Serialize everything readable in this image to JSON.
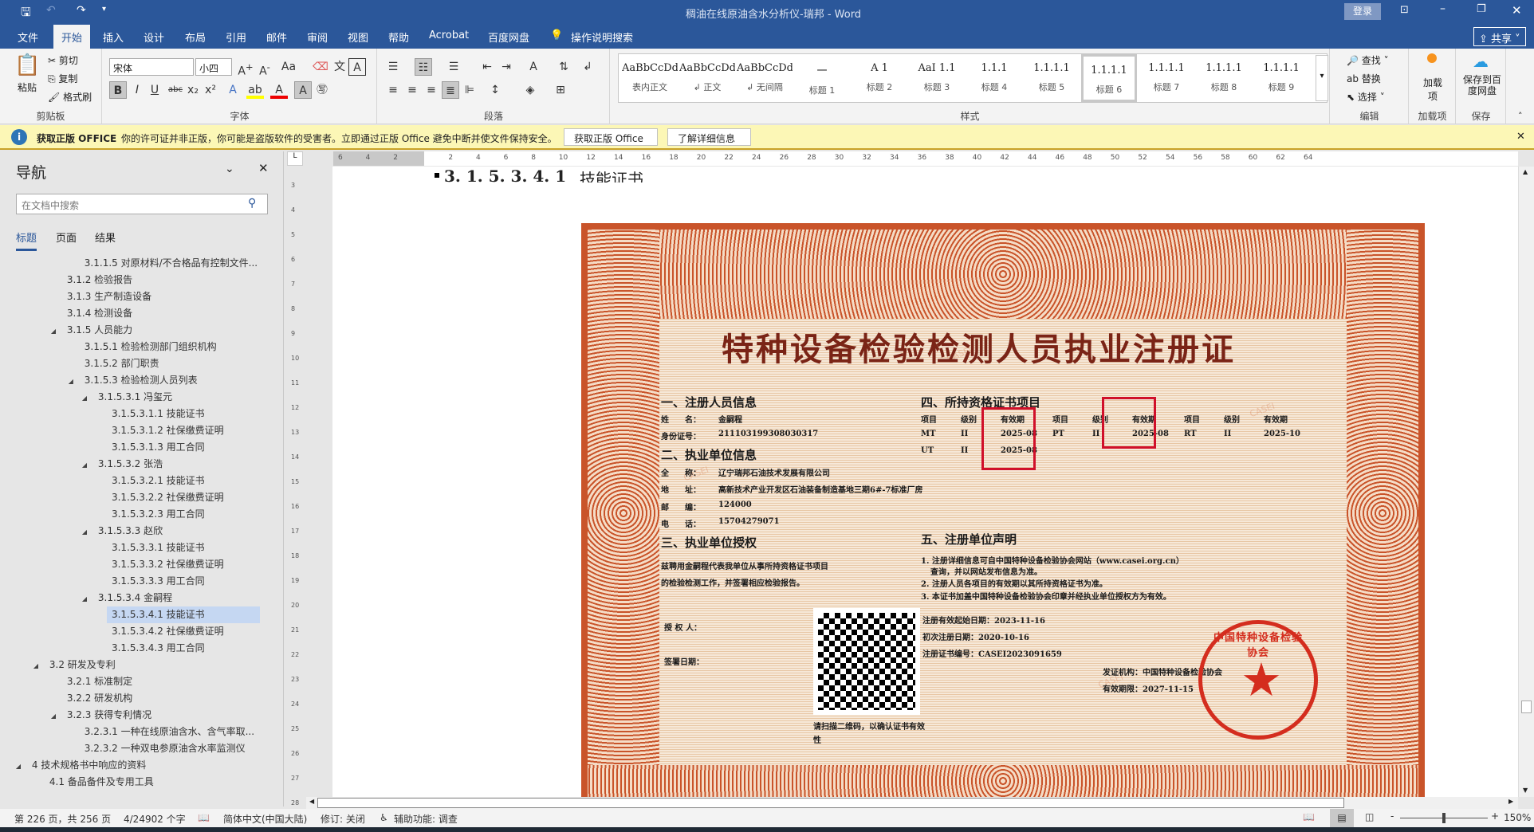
{
  "titlebar": {
    "title": "稠油在线原油含水分析仪-瑞邦 - Word",
    "login": "登录"
  },
  "tabs": [
    "文件",
    "开始",
    "插入",
    "设计",
    "布局",
    "引用",
    "邮件",
    "审阅",
    "视图",
    "帮助",
    "Acrobat",
    "百度网盘"
  ],
  "tell_me": "操作说明搜索",
  "share": "共享",
  "ribbon": {
    "clipboard": {
      "label": "剪贴板",
      "paste": "粘贴",
      "cut": "剪切",
      "copy": "复制",
      "format_painter": "格式刷"
    },
    "font": {
      "label": "字体",
      "font_name": "宋体",
      "font_size": "小四"
    },
    "paragraph": {
      "label": "段落"
    },
    "styles": {
      "label": "样式",
      "items": [
        {
          "preview": "AaBbCcDdI",
          "name": "表内正文"
        },
        {
          "preview": "AaBbCcDdI",
          "name": "↲ 正文"
        },
        {
          "preview": "AaBbCcDdI",
          "name": "↲ 无间隔"
        },
        {
          "preview": "一",
          "name": "标题 1"
        },
        {
          "preview": "A 1",
          "name": "标题 2"
        },
        {
          "preview": "AaI 1.1",
          "name": "标题 3"
        },
        {
          "preview": "1.1.1",
          "name": "标题 4"
        },
        {
          "preview": "1.1.1.1",
          "name": "标题 5"
        },
        {
          "preview": "1.1.1.1",
          "name": "标题 6"
        },
        {
          "preview": "1.1.1.1",
          "name": "标题 7"
        },
        {
          "preview": "1.1.1.1",
          "name": "标题 8"
        },
        {
          "preview": "1.1.1.1",
          "name": "标题 9"
        }
      ]
    },
    "editing": {
      "label": "编辑",
      "find": "查找",
      "replace": "替换",
      "select": "选择"
    },
    "addins": {
      "label": "加载项",
      "button": "加载项"
    },
    "save": {
      "label": "保存",
      "button": "保存到百度网盘"
    }
  },
  "msgbar": {
    "title": "获取正版 OFFICE",
    "text": "你的许可证并非正版，你可能是盗版软件的受害者。立即通过正版 Office 避免中断并使文件保持安全。",
    "btn1": "获取正版 Office",
    "btn2": "了解详细信息"
  },
  "nav": {
    "title": "导航",
    "search_placeholder": "在文档中搜索",
    "tabs": [
      "标题",
      "页面",
      "结果"
    ],
    "items": [
      {
        "level": 3,
        "text": "3.1.1.5 对原材料/不合格品有控制文件..."
      },
      {
        "level": 2,
        "text": "3.1.2 检验报告"
      },
      {
        "level": 2,
        "text": "3.1.3 生产制造设备"
      },
      {
        "level": 2,
        "text": "3.1.4 检测设备"
      },
      {
        "level": 2,
        "text": "3.1.5 人员能力",
        "expanded": true
      },
      {
        "level": 3,
        "text": "3.1.5.1 检验检测部门组织机构"
      },
      {
        "level": 3,
        "text": "3.1.5.2 部门职责"
      },
      {
        "level": 3,
        "text": "3.1.5.3 检验检测人员列表",
        "expanded": true
      },
      {
        "level": 4,
        "text": "3.1.5.3.1 冯玺元",
        "expanded": true
      },
      {
        "level": 5,
        "text": "3.1.5.3.1.1 技能证书"
      },
      {
        "level": 5,
        "text": "3.1.5.3.1.2 社保缴费证明"
      },
      {
        "level": 5,
        "text": "3.1.5.3.1.3 用工合同"
      },
      {
        "level": 4,
        "text": "3.1.5.3.2 张浩",
        "expanded": true
      },
      {
        "level": 5,
        "text": "3.1.5.3.2.1 技能证书"
      },
      {
        "level": 5,
        "text": "3.1.5.3.2.2 社保缴费证明"
      },
      {
        "level": 5,
        "text": "3.1.5.3.2.3 用工合同"
      },
      {
        "level": 4,
        "text": "3.1.5.3.3 赵欣",
        "expanded": true
      },
      {
        "level": 5,
        "text": "3.1.5.3.3.1 技能证书"
      },
      {
        "level": 5,
        "text": "3.1.5.3.3.2 社保缴费证明"
      },
      {
        "level": 5,
        "text": "3.1.5.3.3.3  用工合同"
      },
      {
        "level": 4,
        "text": "3.1.5.3.4 金嗣程",
        "expanded": true
      },
      {
        "level": 5,
        "text": "3.1.5.3.4.1 技能证书",
        "selected": true
      },
      {
        "level": 5,
        "text": "3.1.5.3.4.2 社保缴费证明"
      },
      {
        "level": 5,
        "text": "3.1.5.3.4.3 用工合同"
      },
      {
        "level": 1,
        "text": "3.2 研发及专利",
        "expanded": true
      },
      {
        "level": 2,
        "text": "3.2.1 标准制定"
      },
      {
        "level": 2,
        "text": "3.2.2 研发机构"
      },
      {
        "level": 2,
        "text": "3.2.3 获得专利情况",
        "expanded": true
      },
      {
        "level": 3,
        "text": "3.2.3.1 一种在线原油含水、含气率取..."
      },
      {
        "level": 3,
        "text": "3.2.3.2 一种双电参原油含水率监测仪"
      },
      {
        "level": 0,
        "text": "4 技术规格书中响应的资料",
        "expanded": true
      },
      {
        "level": 1,
        "text": "4.1 备品备件及专用工具"
      }
    ]
  },
  "doc": {
    "heading_num": "3. 1. 5. 3. 4. 1",
    "heading_text": "技能证书",
    "ruler": [
      "6",
      "4",
      "2",
      "",
      "2",
      "4",
      "6",
      "8",
      "10",
      "12",
      "14",
      "16",
      "18",
      "20",
      "22",
      "24",
      "26",
      "28",
      "30",
      "32",
      "34",
      "36",
      "38",
      "40",
      "42",
      "44",
      "46",
      "48",
      "50",
      "52",
      "54",
      "56",
      "58",
      "60",
      "62",
      "64"
    ],
    "vruler": [
      "3",
      "4",
      "5",
      "6",
      "7",
      "8",
      "9",
      "10",
      "11",
      "12",
      "13",
      "14",
      "15",
      "16",
      "17",
      "18",
      "19",
      "20",
      "21",
      "22",
      "23",
      "24",
      "25",
      "26",
      "27",
      "28"
    ]
  },
  "cert": {
    "title": "特种设备检验检测人员执业注册证",
    "watermark": "CASEI",
    "s1": "一、注册人员信息",
    "name_label": "姓　　名：",
    "name": "金嗣程",
    "id_label": "身份证号：",
    "id": "211103199308030317",
    "s2": "二、执业单位信息",
    "org_label": "全　　称：",
    "org": "辽宁瑞邦石油技术发展有限公司",
    "addr_label": "地　　址：",
    "addr": "高新技术产业开发区石油装备制造基地三期6#-7标准厂房",
    "zip_label": "邮　　编：",
    "zip": "124000",
    "tel_label": "电　　话：",
    "tel": "15704279071",
    "s3": "三、执业单位授权",
    "auth1": "兹聘用金嗣程代表我单位从事所持资格证书项目",
    "auth2": "的检验检测工作，并签署相应检验报告。",
    "authorizer": "授 权 人：",
    "sign_date": "签署日期：",
    "s4": "四、所持资格证书项目",
    "table_headers": [
      "项目",
      "级别",
      "有效期",
      "项目",
      "级别",
      "有效期",
      "项目",
      "级别",
      "有效期"
    ],
    "table_rows": [
      [
        "MT",
        "II",
        "2025-08",
        "PT",
        "II",
        "2025-08",
        "RT",
        "II",
        "2025-10"
      ],
      [
        "UT",
        "II",
        "2025-08",
        "",
        "",
        "",
        "",
        "",
        ""
      ]
    ],
    "s5": "五、注册单位声明",
    "stmt1": "1. 注册详细信息可自中国特种设备检验协会网站（www.casei.org.cn）",
    "stmt1b": "查询，并以网站发布信息为准。",
    "stmt2": "2. 注册人员各项目的有效期以其所持资格证书为准。",
    "stmt3": "3. 本证书加盖中国特种设备检验协会印章并经执业单位授权方为有效。",
    "start": "注册有效起始日期：2023-11-16",
    "first": "初次注册日期：2020-10-16",
    "certno": "注册证书编号：CASEI2023091659",
    "qr_caption": "请扫描二维码，以确认证书有效性",
    "issuer": "发证机构：中国特种设备检验协会",
    "expiry": "有效期限：2027-11-15",
    "seal_text": "中国特种设备检验协会"
  },
  "status": {
    "page": "第 226 页，共 256 页",
    "words": "4/24902 个字",
    "lang": "简体中文(中国大陆)",
    "track": "修订: 关闭",
    "access": "辅助功能: 调查",
    "zoom": "150%",
    "zoom_fraction": 0.5
  }
}
